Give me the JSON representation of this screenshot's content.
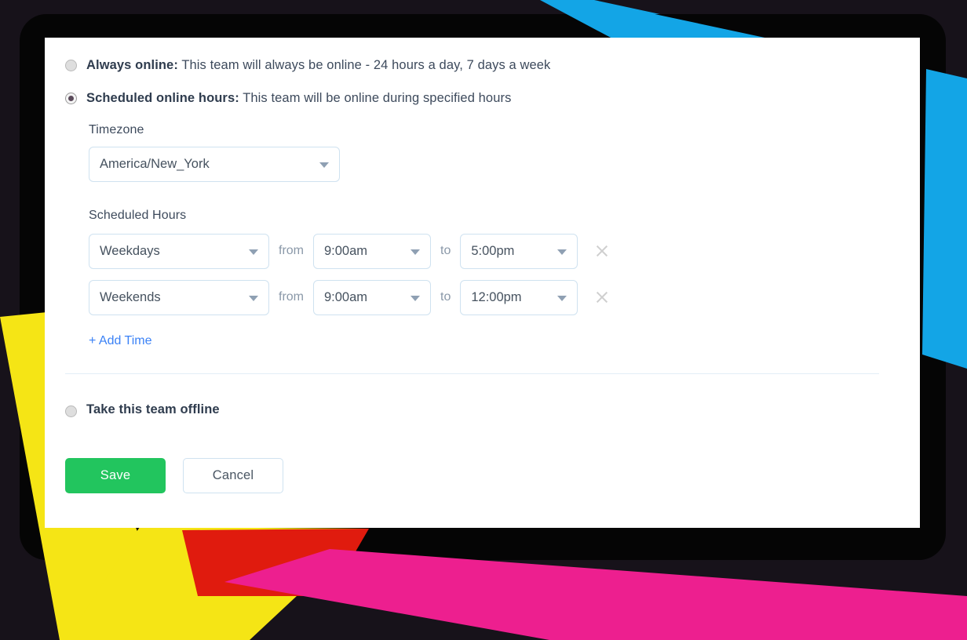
{
  "panel": {
    "options": [
      {
        "id": "always-online",
        "lead": "Always online:",
        "rest": " This team will always be online - 24 hours a day, 7 days a week",
        "selected": false
      },
      {
        "id": "scheduled-online-hours",
        "lead": "Scheduled online hours:",
        "rest": " This team will be online during specified hours",
        "selected": true
      }
    ],
    "timezone": {
      "label": "Timezone",
      "value": "America/New_York",
      "caret_icon": "chevron-down-icon"
    },
    "scheduled_hours": {
      "label": "Scheduled Hours",
      "from_label": "from",
      "to_label": "to",
      "remove_icon": "close-x-icon",
      "rows": [
        {
          "day": "Weekdays",
          "from": "9:00am",
          "to": "5:00pm"
        },
        {
          "day": "Weekends",
          "from": "9:00am",
          "to": "12:00pm"
        }
      ],
      "add_label": "+ Add Time"
    },
    "offline_option": {
      "label": "Take this team offline",
      "selected": false
    },
    "buttons": {
      "save": "Save",
      "cancel": "Cancel"
    }
  },
  "colors": {
    "save_green": "#22c55e",
    "link_blue": "#3b82f6",
    "border_blue": "#cfe2f0",
    "text_navy": "#2f3c4e",
    "deco_cyan": "#13a5e6",
    "deco_yellow": "#f5e515",
    "deco_red": "#e01b0e",
    "deco_magenta": "#ed1f8f",
    "frame_black": "#050505",
    "backdrop": "#17121a"
  }
}
